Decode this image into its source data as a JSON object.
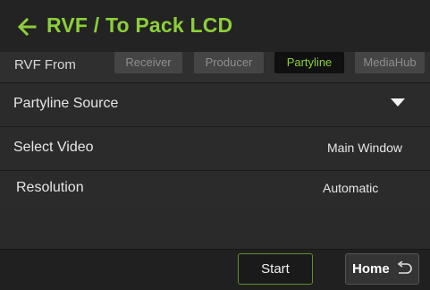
{
  "header": {
    "title": "RVF / To Pack LCD",
    "back_icon": "back-arrow-icon",
    "accent_color": "#8ccf3a"
  },
  "rvf_from": {
    "label": "RVF From",
    "options": [
      {
        "label": "Receiver",
        "selected": false
      },
      {
        "label": "Producer",
        "selected": false
      },
      {
        "label": "Partyline",
        "selected": true
      },
      {
        "label": "MediaHub",
        "selected": false
      }
    ]
  },
  "settings": {
    "source": {
      "label": "Partyline Source",
      "icon": "dropdown-caret-icon"
    },
    "video": {
      "label": "Select Video",
      "value": "Main Window"
    },
    "resolution": {
      "label": "Resolution",
      "value": "Automatic"
    }
  },
  "footer": {
    "start_label": "Start",
    "home_label": "Home",
    "home_icon": "return-arrow-icon"
  }
}
